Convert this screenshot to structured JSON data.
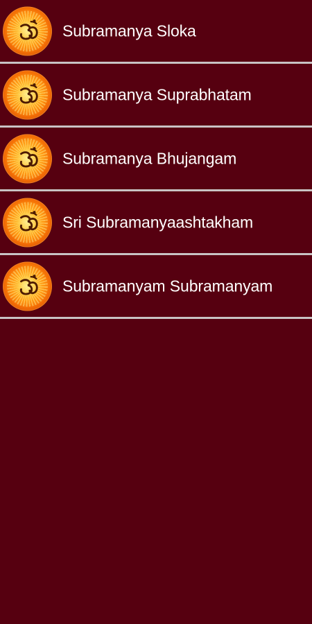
{
  "list": {
    "items": [
      {
        "label": "Subramanya Sloka",
        "icon": "om-icon"
      },
      {
        "label": "Subramanya Suprabhatam",
        "icon": "om-icon"
      },
      {
        "label": "Subramanya Bhujangam",
        "icon": "om-icon"
      },
      {
        "label": "Sri Subramanyaashtakham",
        "icon": "om-icon"
      },
      {
        "label": "Subramanyam Subramanyam",
        "icon": "om-icon"
      }
    ]
  },
  "colors": {
    "background": "#560010",
    "divider": "#c9c3c4",
    "text": "#ffffff",
    "icon_orange": "#f07b0d"
  }
}
